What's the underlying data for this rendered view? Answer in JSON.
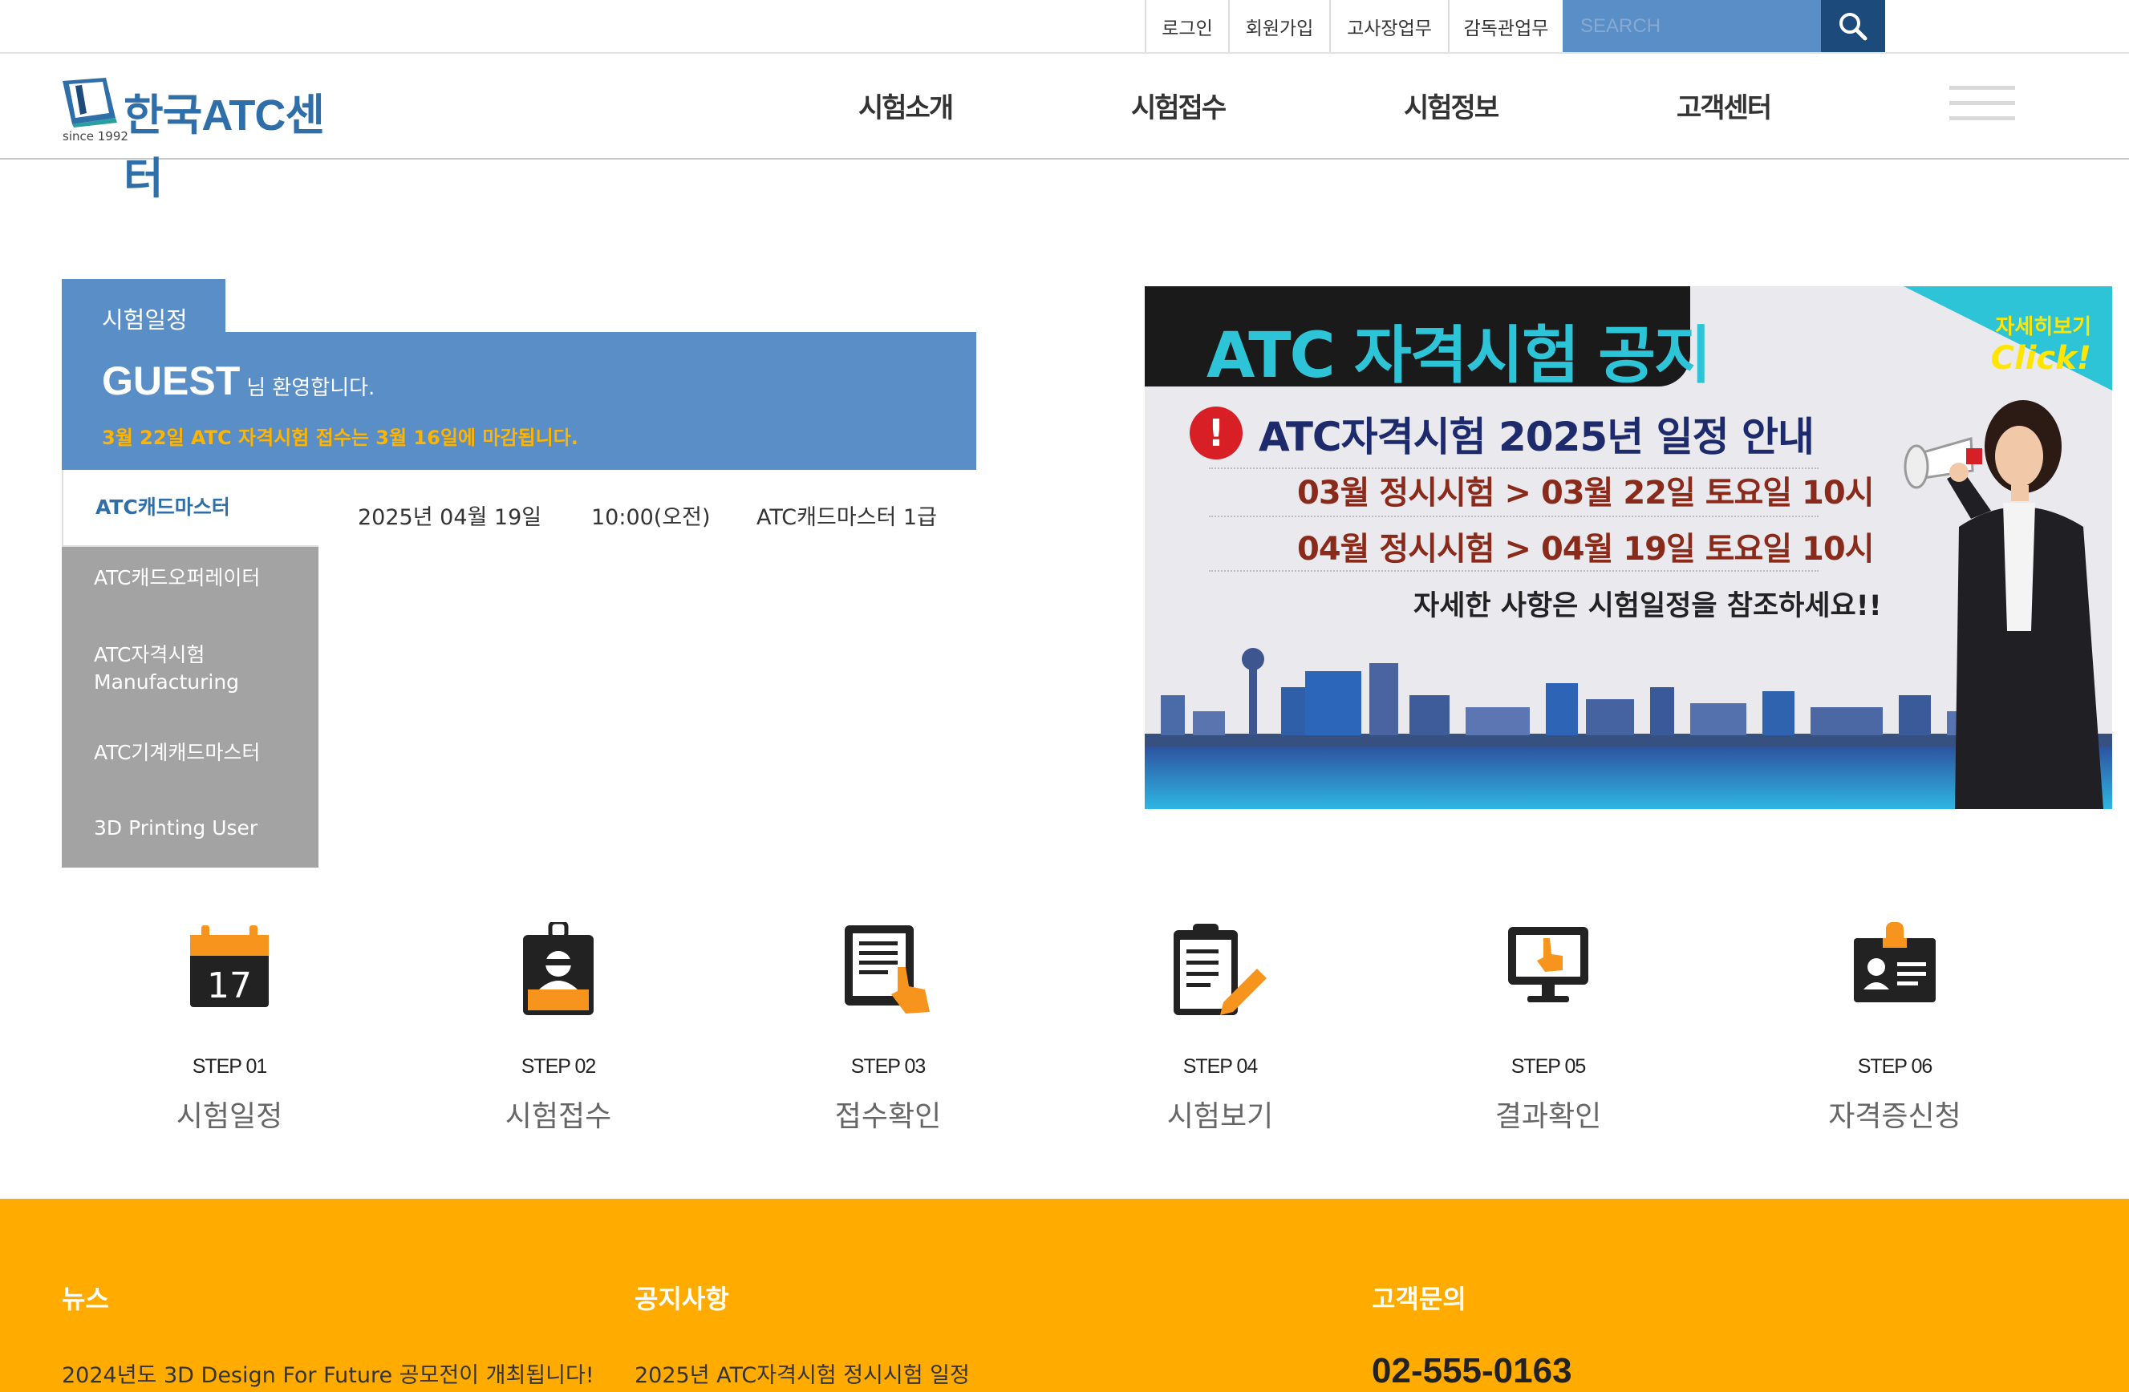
{
  "top_links": [
    "로그인",
    "회원가입",
    "고사장업무",
    "감독관업무"
  ],
  "search": {
    "placeholder": "SEARCH"
  },
  "logo": {
    "name": "한국ATC센터",
    "since": "since 1992"
  },
  "nav": [
    "시험소개",
    "시험접수",
    "시험정보",
    "고객센터"
  ],
  "schedule": {
    "tab": "시험일정",
    "guest_name": "GUEST",
    "welcome": "님 환영합니다.",
    "notice": "3월 22일 ATC 자격시험 접수는 3월 16일에 마감됩니다.",
    "menu": [
      "ATC캐드마스터",
      "ATC캐드오퍼레이터",
      "ATC자격시험\nManufacturing",
      "ATC기계캐드마스터",
      "3D Printing User"
    ],
    "row": {
      "date": "2025년 04월 19일",
      "time": "10:00(오전)",
      "exam": "ATC캐드마스터 1급"
    }
  },
  "banner": {
    "title": "ATC 자격시험 공지",
    "corner_small": "자세히보기",
    "corner_big": "Click!",
    "subtitle": "ATC자격시험 2025년 일정 안내",
    "lines": [
      "03월 정시시험 > 03월 22일 토요일 10시",
      "04월 정시시험 > 04월 19일 토요일 10시"
    ],
    "footnote": "자세한 사항은 시험일정을 참조하세요!!",
    "calendar_day": "17"
  },
  "steps": [
    {
      "num": "STEP 01",
      "label": "시험일정",
      "icon": "calendar-icon"
    },
    {
      "num": "STEP 02",
      "label": "시험접수",
      "icon": "id-badge-icon"
    },
    {
      "num": "STEP 03",
      "label": "접수확인",
      "icon": "tablet-touch-icon"
    },
    {
      "num": "STEP 04",
      "label": "시험보기",
      "icon": "clipboard-pencil-icon"
    },
    {
      "num": "STEP 05",
      "label": "결과확인",
      "icon": "monitor-touch-icon"
    },
    {
      "num": "STEP 06",
      "label": "자격증신청",
      "icon": "id-card-icon"
    }
  ],
  "footer": {
    "news_title": "뉴스",
    "news_item": "2024년도 3D Design For Future 공모전이 개최됩니다!",
    "notice_title": "공지사항",
    "notice_item": "2025년 ATC자격시험 정시시험 일정",
    "contact_title": "고객문의",
    "phone": "02-555-0163"
  },
  "colors": {
    "primary_blue": "#5a8ec7",
    "dark_blue": "#1b4a7b",
    "footer_orange": "#ffab00",
    "accent_orange": "#f7941d"
  }
}
